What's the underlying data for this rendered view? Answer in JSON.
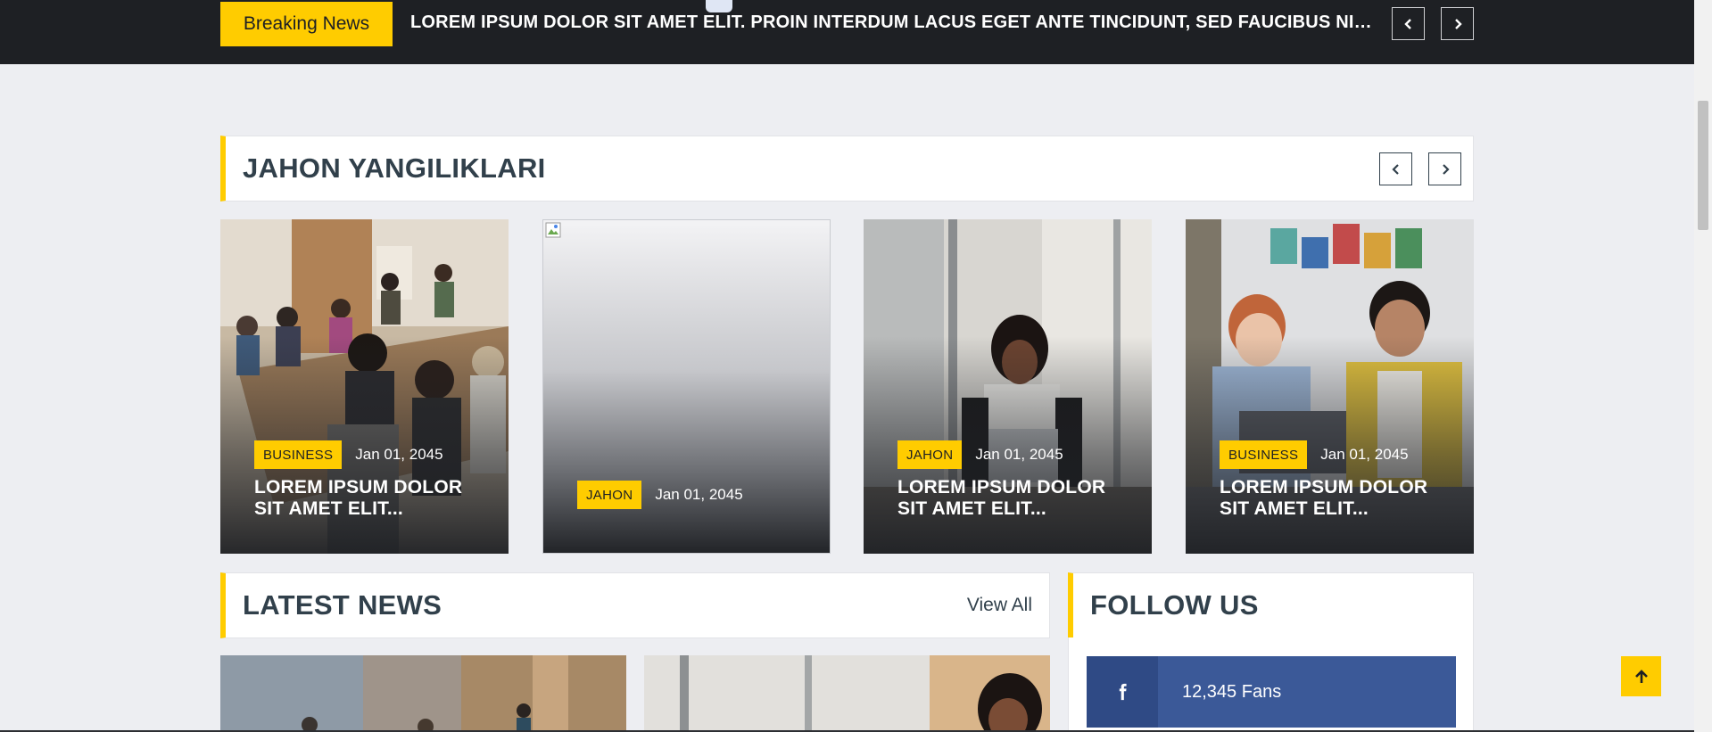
{
  "breaking": {
    "label": "Breaking News",
    "text": "LOREM IPSUM DOLOR SIT AMET ELIT. PROIN INTERDUM LACUS EGET ANTE TINCIDUNT, SED FAUCIBUS NISL SODALES"
  },
  "jahon": {
    "title": "JAHON YANGILIKLARI",
    "cards": [
      {
        "category": "BUSINESS",
        "date": "Jan 01, 2045",
        "headline": "LOREM IPSUM DOLOR SIT AMET ELIT..."
      },
      {
        "category": "JAHON",
        "date": "Jan 01, 2045",
        "headline": ""
      },
      {
        "category": "JAHON",
        "date": "Jan 01, 2045",
        "headline": "LOREM IPSUM DOLOR SIT AMET ELIT..."
      },
      {
        "category": "BUSINESS",
        "date": "Jan 01, 2045",
        "headline": "LOREM IPSUM DOLOR SIT AMET ELIT..."
      }
    ]
  },
  "latest": {
    "title": "LATEST NEWS",
    "view_all": "View All"
  },
  "follow": {
    "title": "FOLLOW US",
    "facebook_fans": "12,345 Fans"
  },
  "colors": {
    "accent": "#ffcc00",
    "dark": "#1e2024",
    "heading": "#31404b",
    "facebook": "#3b5998"
  },
  "icons": {
    "prev": "chevron-left-icon",
    "next": "chevron-right-icon",
    "facebook": "facebook-icon",
    "back_to_top": "arrow-up-icon"
  }
}
